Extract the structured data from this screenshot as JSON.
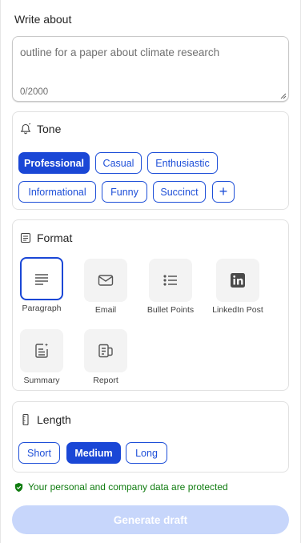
{
  "write_about": {
    "title": "Write about",
    "placeholder": "outline for a paper about climate research",
    "counter": "0/2000"
  },
  "tone": {
    "title": "Tone",
    "chips": [
      {
        "label": "Professional",
        "selected": true
      },
      {
        "label": "Casual",
        "selected": false
      },
      {
        "label": "Enthusiastic",
        "selected": false
      },
      {
        "label": "Informational",
        "selected": false
      },
      {
        "label": "Funny",
        "selected": false
      },
      {
        "label": "Succinct",
        "selected": false
      }
    ],
    "add_label": "+"
  },
  "format": {
    "title": "Format",
    "items": [
      {
        "label": "Paragraph",
        "icon": "paragraph-icon",
        "selected": true
      },
      {
        "label": "Email",
        "icon": "email-icon",
        "selected": false
      },
      {
        "label": "Bullet Points",
        "icon": "bullet-list-icon",
        "selected": false
      },
      {
        "label": "LinkedIn Post",
        "icon": "linkedin-icon",
        "selected": false
      },
      {
        "label": "Summary",
        "icon": "summary-icon",
        "selected": false
      },
      {
        "label": "Report",
        "icon": "report-icon",
        "selected": false
      }
    ]
  },
  "length": {
    "title": "Length",
    "chips": [
      {
        "label": "Short",
        "selected": false
      },
      {
        "label": "Medium",
        "selected": true
      },
      {
        "label": "Long",
        "selected": false
      }
    ]
  },
  "privacy_notice": "Your personal and company data are protected",
  "generate_label": "Generate draft",
  "colors": {
    "accent": "#1a47d6",
    "generate_disabled": "#c7d6fb",
    "privacy_green": "#107c10"
  }
}
